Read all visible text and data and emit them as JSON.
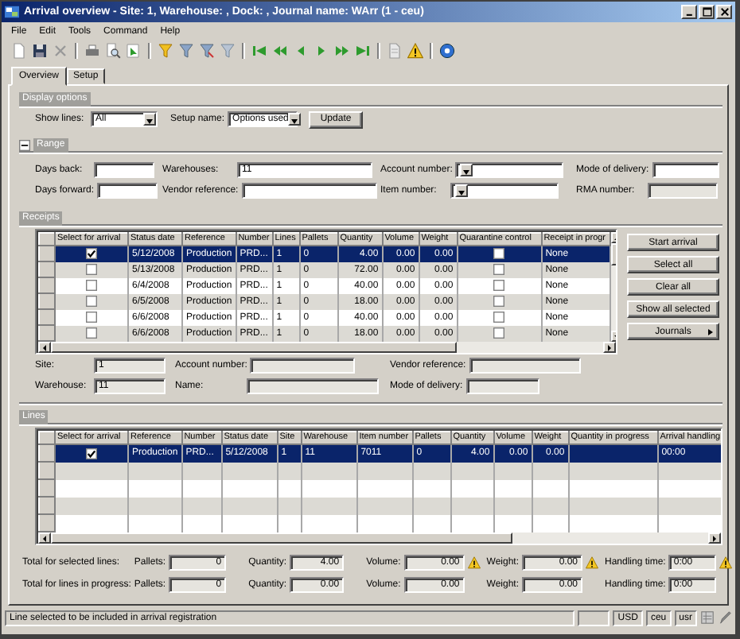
{
  "window": {
    "title": "Arrival overview - Site: 1, Warehouse: , Dock: , Journal name: WArr (1 - ceu)"
  },
  "menu": [
    "File",
    "Edit",
    "Tools",
    "Command",
    "Help"
  ],
  "tabs": [
    {
      "label": "Overview",
      "selected": true
    },
    {
      "label": "Setup",
      "selected": false
    }
  ],
  "display_options": {
    "title": "Display options",
    "fields": [
      {
        "label": "Show lines:",
        "value": "All",
        "kind": "combo"
      },
      {
        "label": "Setup name:",
        "value": "Options used",
        "kind": "combo"
      }
    ],
    "button": "Update"
  },
  "range": {
    "title": "Range",
    "expanded": true,
    "fields": [
      {
        "label": "Days back:",
        "kind": "text",
        "disabled": false
      },
      {
        "label": "Warehouses:",
        "value": "11",
        "kind": "text",
        "disabled": false
      },
      {
        "label": "Account number:",
        "kind": "combo",
        "disabled": false
      },
      {
        "label": "Mode of delivery:",
        "kind": "text",
        "disabled": false
      },
      {
        "label": "Days forward:",
        "kind": "text",
        "disabled": false
      },
      {
        "label": "Vendor reference:",
        "kind": "text",
        "disabled": false
      },
      {
        "label": "Item number:",
        "kind": "combo",
        "disabled": false
      },
      {
        "label": "RMA number:",
        "kind": "text",
        "disabled": true
      }
    ]
  },
  "receipts": {
    "title": "Receipts",
    "columns": [
      {
        "label": "Select for arrival",
        "kind": "check"
      },
      {
        "label": "Status date",
        "kind": "text"
      },
      {
        "label": "Reference",
        "kind": "text"
      },
      {
        "label": "Number",
        "kind": "text"
      },
      {
        "label": "Lines",
        "kind": "text"
      },
      {
        "label": "Pallets",
        "kind": "text"
      },
      {
        "label": "Quantity",
        "kind": "number"
      },
      {
        "label": "Volume",
        "kind": "number"
      },
      {
        "label": "Weight",
        "kind": "number"
      },
      {
        "label": "Quarantine control",
        "kind": "check"
      },
      {
        "label": "Receipt in progr",
        "kind": "text"
      }
    ],
    "rows": [
      {
        "selected": true,
        "values": {
          "select": true,
          "status_date": "5/12/2008",
          "reference": "Production",
          "number": "PRD...",
          "lines": "1",
          "pallets": "0",
          "quantity": "4.00",
          "volume": "0.00",
          "weight": "0.00",
          "quarantine": false,
          "receipt_in_progress": "None"
        }
      },
      {
        "selected": false,
        "values": {
          "select": false,
          "status_date": "5/13/2008",
          "reference": "Production",
          "number": "PRD...",
          "lines": "1",
          "pallets": "0",
          "quantity": "72.00",
          "volume": "0.00",
          "weight": "0.00",
          "quarantine": false,
          "receipt_in_progress": "None"
        }
      },
      {
        "selected": false,
        "values": {
          "select": false,
          "status_date": "6/4/2008",
          "reference": "Production",
          "number": "PRD...",
          "lines": "1",
          "pallets": "0",
          "quantity": "40.00",
          "volume": "0.00",
          "weight": "0.00",
          "quarantine": false,
          "receipt_in_progress": "None"
        }
      },
      {
        "selected": false,
        "values": {
          "select": false,
          "status_date": "6/5/2008",
          "reference": "Production",
          "number": "PRD...",
          "lines": "1",
          "pallets": "0",
          "quantity": "18.00",
          "volume": "0.00",
          "weight": "0.00",
          "quarantine": false,
          "receipt_in_progress": "None"
        }
      },
      {
        "selected": false,
        "values": {
          "select": false,
          "status_date": "6/6/2008",
          "reference": "Production",
          "number": "PRD...",
          "lines": "1",
          "pallets": "0",
          "quantity": "40.00",
          "volume": "0.00",
          "weight": "0.00",
          "quarantine": false,
          "receipt_in_progress": "None"
        }
      },
      {
        "selected": false,
        "values": {
          "select": false,
          "status_date": "6/6/2008",
          "reference": "Production",
          "number": "PRD...",
          "lines": "1",
          "pallets": "0",
          "quantity": "18.00",
          "volume": "0.00",
          "weight": "0.00",
          "quarantine": false,
          "receipt_in_progress": "None"
        }
      }
    ]
  },
  "actions": [
    {
      "label": "Start arrival",
      "kind": "button"
    },
    {
      "label": "Select all",
      "kind": "button"
    },
    {
      "label": "Clear all",
      "kind": "button"
    },
    {
      "label": "Show all selected",
      "kind": "button"
    },
    {
      "label": "Journals",
      "kind": "menu"
    }
  ],
  "details": [
    {
      "label": "Site:",
      "value": "1",
      "disabled": true
    },
    {
      "label": "Account number:",
      "disabled": true
    },
    {
      "label": "Vendor reference:",
      "disabled": true
    },
    {
      "label": "Warehouse:",
      "value": "11",
      "disabled": true
    },
    {
      "label": "Name:",
      "disabled": true
    },
    {
      "label": "Mode of delivery:",
      "disabled": true
    }
  ],
  "lines": {
    "title": "Lines",
    "columns": [
      {
        "label": "Select for arrival",
        "kind": "check"
      },
      {
        "label": "Reference",
        "kind": "text"
      },
      {
        "label": "Number",
        "kind": "text"
      },
      {
        "label": "Status date",
        "kind": "text"
      },
      {
        "label": "Site",
        "kind": "text"
      },
      {
        "label": "Warehouse",
        "kind": "text"
      },
      {
        "label": "Item number",
        "kind": "text"
      },
      {
        "label": "Pallets",
        "kind": "text"
      },
      {
        "label": "Quantity",
        "kind": "number"
      },
      {
        "label": "Volume",
        "kind": "number"
      },
      {
        "label": "Weight",
        "kind": "number"
      },
      {
        "label": "Quantity in progress",
        "kind": "text"
      },
      {
        "label": "Arrival handling",
        "kind": "text"
      }
    ],
    "rows": [
      {
        "selected": true,
        "values": {
          "select": true,
          "reference": "Production",
          "number": "PRD...",
          "status_date": "5/12/2008",
          "site": "1",
          "warehouse": "11",
          "item_number": "7011",
          "pallets": "0",
          "quantity": "4.00",
          "volume": "0.00",
          "weight": "0.00",
          "arrival_handling": "00:00"
        }
      }
    ]
  },
  "totals": [
    {
      "label": "Total for selected lines:",
      "fields": [
        {
          "label": "Pallets:",
          "value": "0",
          "kind": "number",
          "warning": false
        },
        {
          "label": "Quantity:",
          "value": "4.00",
          "kind": "number",
          "warning": false
        },
        {
          "label": "Volume:",
          "value": "0.00",
          "kind": "number",
          "warning": true
        },
        {
          "label": "Weight:",
          "value": "0.00",
          "kind": "number",
          "warning": true
        },
        {
          "label": "Handling time:",
          "value": "0:00",
          "kind": "time",
          "warning": true
        }
      ]
    },
    {
      "label": "Total for lines in progress:",
      "fields": [
        {
          "label": "Pallets:",
          "value": "0",
          "kind": "number",
          "warning": false
        },
        {
          "label": "Quantity:",
          "value": "0.00",
          "kind": "number",
          "warning": false
        },
        {
          "label": "Volume:",
          "value": "0.00",
          "kind": "number",
          "warning": false
        },
        {
          "label": "Weight:",
          "value": "0.00",
          "kind": "number",
          "warning": false
        },
        {
          "label": "Handling time:",
          "value": "0:00",
          "kind": "time",
          "warning": false
        }
      ]
    }
  ],
  "status_bar": {
    "message": "Line selected to be included in arrival registration",
    "indicators": [
      "USD",
      "ceu",
      "usr"
    ]
  }
}
